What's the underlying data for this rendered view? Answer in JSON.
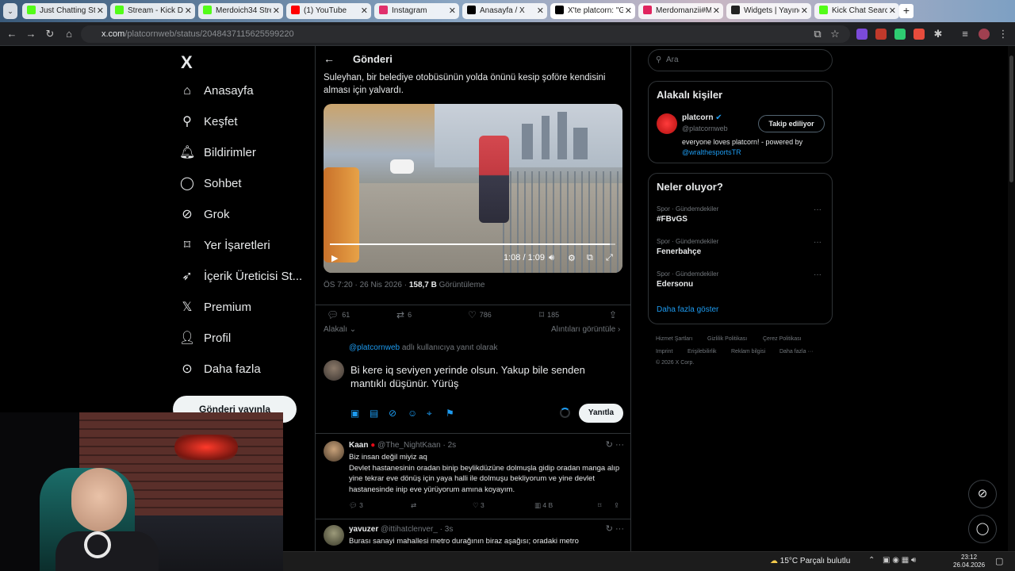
{
  "browser": {
    "tabs": [
      {
        "label": "Just Chatting Stre",
        "color": "#53fc18"
      },
      {
        "label": "Stream - Kick Da",
        "color": "#53fc18"
      },
      {
        "label": "Merdoich34 Strea",
        "color": "#53fc18"
      },
      {
        "label": "(1) YouTube",
        "color": "#ff0000"
      },
      {
        "label": "Instagram",
        "color": "#e1306c"
      },
      {
        "label": "Anasayfa / X",
        "color": "#000000"
      },
      {
        "label": "X'te platcorn: \"G",
        "color": "#000000"
      },
      {
        "label": "Merdomanzii#Mi",
        "color": "#e0245e"
      },
      {
        "label": "Widgets | Yayıncı",
        "color": "#222222"
      },
      {
        "label": "Kick Chat Search",
        "color": "#53fc18"
      }
    ],
    "url_domain": "x.com",
    "url_path": "/platcornweb/status/2048437115625599220"
  },
  "nav": {
    "logo": "X",
    "items": [
      {
        "label": "Anasayfa",
        "icon": "home-icon"
      },
      {
        "label": "Keşfet",
        "icon": "search-icon"
      },
      {
        "label": "Bildirimler",
        "icon": "bell-icon"
      },
      {
        "label": "Sohbet",
        "icon": "chat-icon"
      },
      {
        "label": "Grok",
        "icon": "grok-icon"
      },
      {
        "label": "Yer İşaretleri",
        "icon": "bookmark-icon"
      },
      {
        "label": "İçerik Üreticisi St...",
        "icon": "rocket-icon"
      },
      {
        "label": "Premium",
        "icon": "x-icon"
      },
      {
        "label": "Profil",
        "icon": "person-icon"
      },
      {
        "label": "Daha fazla",
        "icon": "more-circle-icon"
      }
    ],
    "post_button": "Gönderi yayınla"
  },
  "post": {
    "header_title": "Gönderi",
    "text": "Suleyhan, bir belediye otobüsünün yolda önünü kesip şoföre kendisini alması için yalvardı.",
    "video_time": "1:08 / 1:09",
    "video_progress": 0.98,
    "timestamp": "ÖS 7:20 · 26 Nis 2026 · ",
    "views_count": "158,7 B",
    "views_label": " Görüntüleme",
    "replies": "61",
    "reposts": "6",
    "likes": "786",
    "bookmarks": "185",
    "sort_label": "Alakalı",
    "quotes_label": "Alıntıları görüntüle"
  },
  "compose": {
    "reply_handle": "@platcornweb",
    "reply_suffix": " adlı kullanıcıya yanıt olarak",
    "text": "Bi kere iq seviyen yerinde olsun. Yakup bile senden mantıklı düşünür. Yürüş",
    "reply_button": "Yanıtla"
  },
  "replies": [
    {
      "name": "Kaan",
      "handle": "@The_NightKaan · 2s",
      "lines": [
        "Biz insan değil miyiz aq",
        "Devlet hastanesinin oradan binip beylikdüzüne dolmuşla gidip oradan manga alıp yine tekrar eve dönüş için yaya halli ile dolmuşu bekliyorum ve yine devlet hastanesinde inip eve yürüyorum amına koyayım."
      ],
      "replies": "3",
      "likes": "3",
      "views": "4 B"
    },
    {
      "name": "yavuzer",
      "handle": "@ittihatclenver_ · 3s",
      "lines": [
        "Burası sanayi mahallesi metro durağının biraz aşağısı; oradaki metro"
      ]
    }
  ],
  "sidebar": {
    "search_placeholder": "Ara",
    "relevant_title": "Alakalı kişiler",
    "person_name": "platcorn",
    "person_handle": "@platcornweb",
    "follow_button": "Takip ediliyor",
    "person_bio": "everyone loves platcorn! - powered by ",
    "person_bio_link": "@wralthesportsTR",
    "trends_title": "Neler oluyor?",
    "trends": [
      {
        "category": "Spor · Gündemdekiler",
        "name": "#FBvGS"
      },
      {
        "category": "Spor · Gündemdekiler",
        "name": "Fenerbahçe"
      },
      {
        "category": "Spor · Gündemdekiler",
        "name": "Edersonu"
      }
    ],
    "show_more": "Daha fazla göster",
    "footer": [
      "Hizmet Şartları",
      "Gizlilik Politikası",
      "Çerez Politikası",
      "Imprint",
      "Erişilebilirlik",
      "Reklam bilgisi",
      "Daha fazla ···",
      "© 2026 X Corp."
    ]
  },
  "taskbar": {
    "weather": "15°C  Parçalı bulutlu",
    "time": "23:12",
    "date": "26.04.2026"
  }
}
